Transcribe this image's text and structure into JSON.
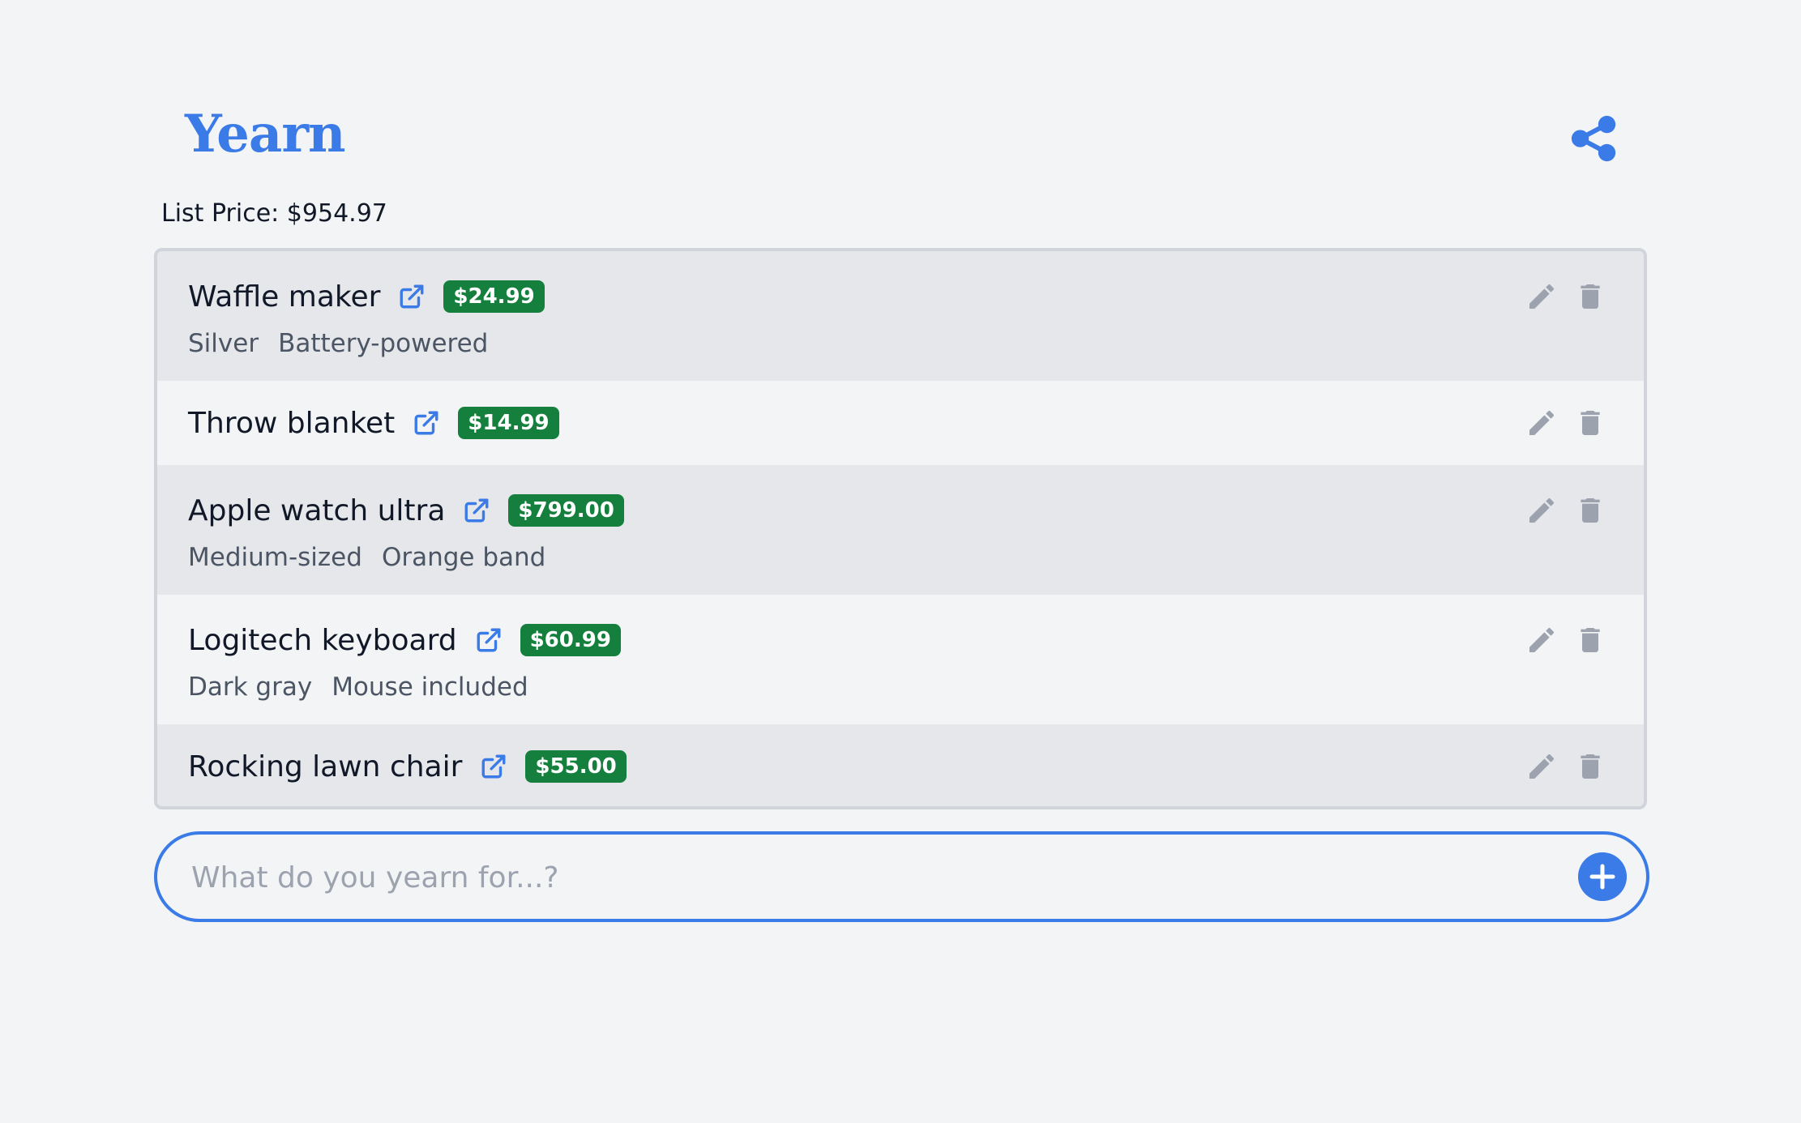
{
  "app": {
    "logo_text": "Yearn",
    "accent_color": "#3b7be8"
  },
  "header": {
    "share_icon": "share-icon"
  },
  "summary": {
    "list_price": "List Price: $954.97"
  },
  "items": [
    {
      "name": "Waffle maker",
      "price": "$24.99",
      "tags": [
        "Silver",
        "Battery-powered"
      ]
    },
    {
      "name": "Throw blanket",
      "price": "$14.99",
      "tags": []
    },
    {
      "name": "Apple watch ultra",
      "price": "$799.00",
      "tags": [
        "Medium-sized",
        "Orange band"
      ]
    },
    {
      "name": "Logitech keyboard",
      "price": "$60.99",
      "tags": [
        "Dark gray",
        "Mouse included"
      ]
    },
    {
      "name": "Rocking lawn chair",
      "price": "$55.00",
      "tags": []
    }
  ],
  "colors": {
    "price_badge": "#15803d",
    "action_icon": "#9ca3af"
  },
  "composer": {
    "placeholder": "What do you yearn for...?",
    "value": "",
    "add_icon": "plus-icon"
  }
}
